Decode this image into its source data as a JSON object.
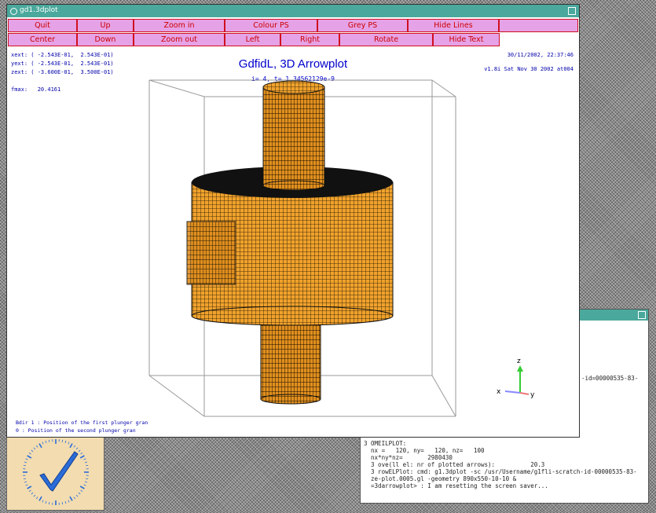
{
  "main_window": {
    "title": "gd1.3dplot",
    "buttons_row1": [
      "Quit",
      "Up",
      "Zoom in",
      "Colour PS",
      "Grey PS",
      "Hide Lines",
      ""
    ],
    "buttons_row2": [
      "Center",
      "Down",
      "Zoom out",
      "Left",
      "Right",
      "Rotate",
      "Hide Text"
    ],
    "plot": {
      "title": "GdfidL, 3D Arrowplot",
      "subtitle": "i= 4, t= 1.34562129e-9",
      "xext": "xext: ( -2.543E-01,  2.543E-01)",
      "yext": "yext: ( -2.543E-01,  2.543E-01)",
      "zext": "zext: ( -3.600E-01,  3.500E-01)",
      "fmax": "fmax:   20.4161",
      "date": "30/11/2002, 22:37:46",
      "version": "v1.8i Sat Nov 30 2002 at004",
      "legend_line1": "Bdir 1 : Position of the first plunger gran",
      "legend_line2": "0 : Position of the second plunger gran",
      "axis_labels": {
        "x": "x",
        "y": "y",
        "z": "z"
      }
    }
  },
  "terminal": {
    "lines": [
      "3 OMEILPLOT:",
      "  nx =   120, ny=   120, nz=   100",
      "  nx*ny*nz=       2980430",
      "  3 ove(ll el: nr of plotted arrows):          20.3",
      "",
      "  3 rowELPlot: cmd: g1.3dplot -sc /usr/Username/g1fli-scratch-id-00000535-83-",
      "  ze-plot.0005.gl -geometry 890x550-10-10 &",
      "  =3darrowplot> : I am resetting the screen saver..."
    ],
    "side_text": "-id=00000535-83-"
  },
  "colors": {
    "titlebar": "#4aa89c",
    "button_bg": "#e6a2e6",
    "button_text": "#cc0000",
    "plot_text": "#0000cc",
    "mesh_fill": "#f0a22c"
  },
  "icons": [
    "window-menu-icon",
    "maximize-icon",
    "clock-icon",
    "axis-triad-icon"
  ]
}
